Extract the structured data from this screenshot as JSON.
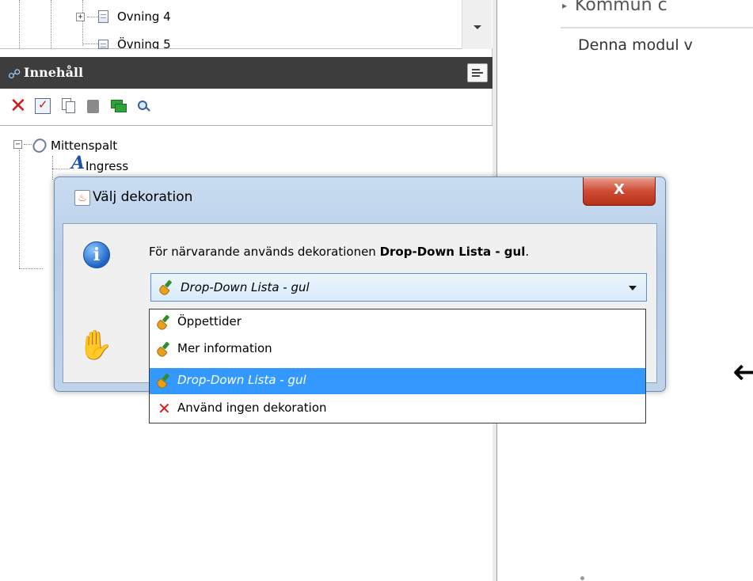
{
  "top_tree": {
    "items": [
      {
        "label": "Ovning 4"
      },
      {
        "label": "Övning 5"
      }
    ]
  },
  "panel": {
    "title": "Innehåll",
    "toolbar": [
      "delete-icon",
      "check-icon",
      "copy-icon",
      "paste-icon",
      "move-icon",
      "search-icon"
    ]
  },
  "tree": {
    "root": "Mittenspalt",
    "child": "Ingress"
  },
  "right": {
    "bullet": "Kommun c",
    "module_text": "Denna modul v"
  },
  "dialog": {
    "title": "Välj dekoration",
    "close_label": "X",
    "message_prefix": "För närvarande används dekorationen ",
    "message_bold": "Drop-Down Lista - gul",
    "message_suffix": ".",
    "selected_value": "Drop-Down Lista - gul",
    "options": [
      {
        "label": "Öppettider",
        "icon": "brush-icon"
      },
      {
        "label": "Mer information",
        "icon": "brush-icon"
      },
      {
        "label": "Drop-Down Lista - gul",
        "icon": "brush-icon",
        "selected": true
      },
      {
        "label": "Använd ingen dekoration",
        "icon": "x-icon"
      }
    ]
  },
  "colors": {
    "header_bg": "#3d3d3d",
    "selection": "#3399ff",
    "close_red": "#cf4b33",
    "dialog_frame": "#bfd3ea"
  }
}
